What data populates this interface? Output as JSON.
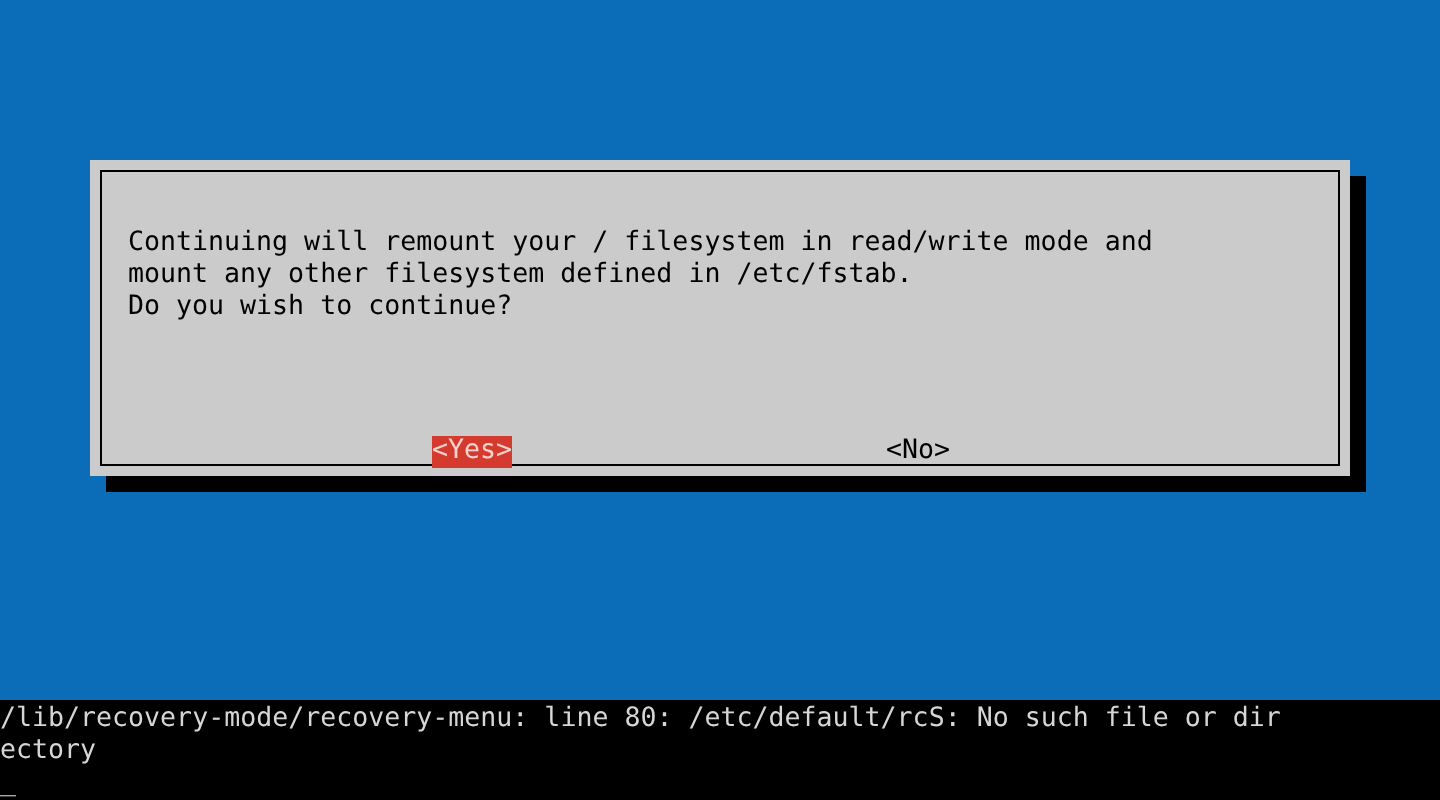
{
  "dialog": {
    "message": [
      "Continuing will remount your / filesystem in read/write mode and",
      "mount any other filesystem defined in /etc/fstab.",
      "Do you wish to continue?"
    ],
    "buttons": [
      {
        "label": "<Yes>",
        "selected": true
      },
      {
        "label": "<No>",
        "selected": false
      }
    ]
  },
  "console": {
    "lines": [
      "/lib/recovery-mode/recovery-menu: line 80: /etc/default/rcS: No such file or dir",
      "ectory"
    ],
    "cursor": "_"
  }
}
